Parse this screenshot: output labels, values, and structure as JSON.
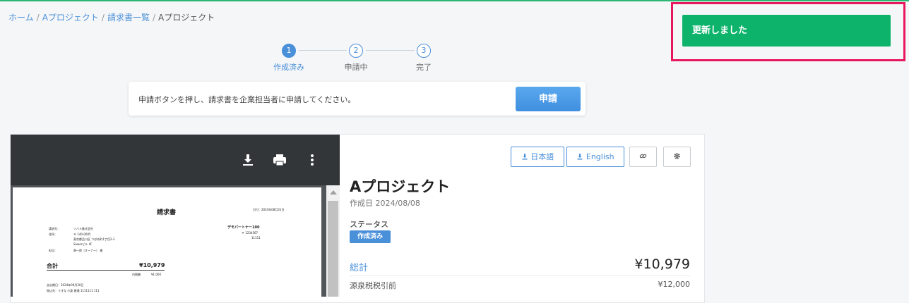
{
  "breadcrumb": {
    "home": "ホーム",
    "project": "Aプロジェクト",
    "invoices": "請求書一覧",
    "current": "Aプロジェクト",
    "separator": "/"
  },
  "toast": {
    "message": "更新しました",
    "color": "#0db36a"
  },
  "stepper": {
    "steps": [
      {
        "number": "1",
        "label": "作成済み",
        "state": "active"
      },
      {
        "number": "2",
        "label": "申請中",
        "state": "pending"
      },
      {
        "number": "3",
        "label": "完了",
        "state": "pending"
      }
    ]
  },
  "apply": {
    "message": "申請ボタンを押し、請求書を企業担当者に申請してください。",
    "button": "申請"
  },
  "pdf_viewer": {
    "icons": [
      "download-icon",
      "print-icon",
      "more-vert-icon"
    ],
    "document": {
      "title": "請求書",
      "date": "日付：2024年08月31日",
      "to_label": "請求先：",
      "to_value": "ソバメ株式会社",
      "address_label": "住所：",
      "address_line1": "〒 140-0005",
      "address_line2": "東京都品川区 つばめ町1丁目2-3",
      "address_line3": "Sowerビル 4F",
      "contact_label": "担当：",
      "contact_value": "燕一郎（オーナー） 様",
      "partner": "デモパートナー100",
      "partner_postal": "〒 1234567",
      "partner_line2": "11111",
      "total_label": "合計",
      "total_value": "¥10,979",
      "withholding_label": "内税額",
      "withholding_value": "¥1,000",
      "payment_due": "支払期日：2024年09月30日",
      "bank": "振込先：うきな 小倉 普通 1111111 111"
    }
  },
  "details": {
    "download_ja": "日本語",
    "download_en": "English",
    "link_icon": "link-icon",
    "settings_icon": "gear-icon",
    "project_title": "Aプロジェクト",
    "created": "作成日 2024/08/08",
    "status_label": "ステータス",
    "status_value": "作成済み",
    "total_label": "総計",
    "total_value": "¥10,979",
    "withholding_label": "源泉税税引前",
    "withholding_value": "¥12,000"
  },
  "colors": {
    "accent": "#4a90d9",
    "success": "#0db36a",
    "highlight_border": "#e8175d"
  }
}
